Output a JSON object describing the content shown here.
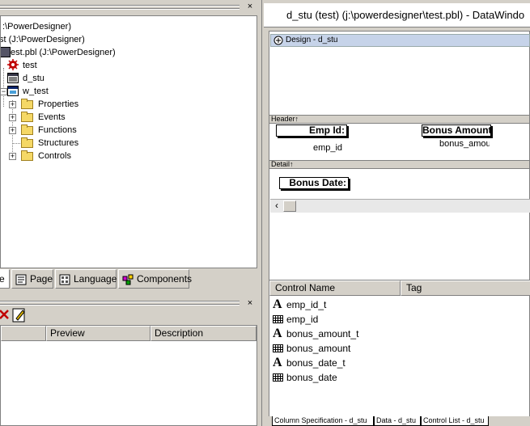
{
  "tree": {
    "items": [
      {
        "label": ":\\PowerDesigner)"
      },
      {
        "label": "st (J:\\PowerDesigner)"
      },
      {
        "label": "test.pbl (J:\\PowerDesigner)"
      },
      {
        "label": "test"
      },
      {
        "label": "d_stu"
      },
      {
        "label": "w_test"
      },
      {
        "label": "Properties"
      },
      {
        "label": "Events"
      },
      {
        "label": "Functions"
      },
      {
        "label": "Structures"
      },
      {
        "label": "Controls"
      }
    ]
  },
  "left_tabs": [
    {
      "label": "e"
    },
    {
      "label": "Page"
    },
    {
      "label": "Language"
    },
    {
      "label": "Components"
    }
  ],
  "bottom_list": {
    "columns": [
      "Preview",
      "Description"
    ]
  },
  "datawindow": {
    "title": "d_stu  (test) (j:\\powerdesigner\\test.pbl) - DataWindo",
    "design_caption": "Design - d_stu",
    "header_band": "Header↑",
    "detail_band": "Detail↑",
    "labels": {
      "emp_id_t": "Emp Id:",
      "bonus_amount_t": "Bonus Amount:",
      "bonus_date_t": "Bonus Date:"
    },
    "fields": {
      "emp_id": "emp_id",
      "bonus_amount": "bonus_amou"
    }
  },
  "control_list": {
    "columns": [
      "Control Name",
      "Tag"
    ],
    "rows": [
      {
        "name": "emp_id_t",
        "icon": "text-icon"
      },
      {
        "name": "emp_id",
        "icon": "column-icon"
      },
      {
        "name": "bonus_amount_t",
        "icon": "text-icon"
      },
      {
        "name": "bonus_amount",
        "icon": "column-icon"
      },
      {
        "name": "bonus_date_t",
        "icon": "text-icon"
      },
      {
        "name": "bonus_date",
        "icon": "column-icon"
      }
    ]
  },
  "bottom_tabs": [
    {
      "label": "Column Specification - d_stu"
    },
    {
      "label": "Data - d_stu"
    },
    {
      "label": "Control List - d_stu"
    }
  ]
}
